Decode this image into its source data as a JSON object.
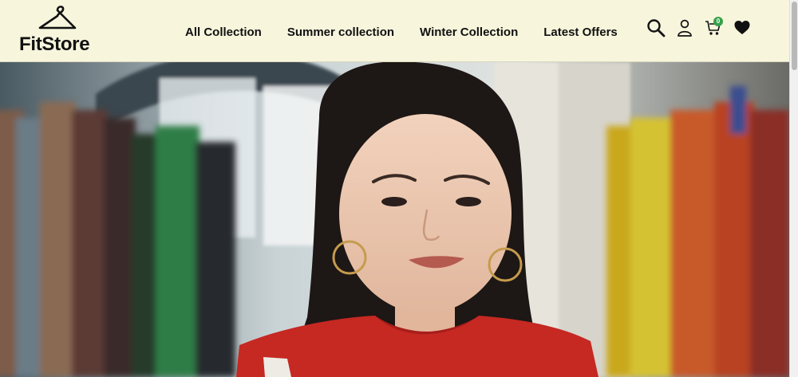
{
  "brand": {
    "name": "FitStore",
    "logo_icon": "hanger-icon"
  },
  "nav": {
    "items": [
      {
        "label": "All Collection"
      },
      {
        "label": "Summer collection"
      },
      {
        "label": "Winter Collection"
      },
      {
        "label": "Latest Offers"
      }
    ]
  },
  "actions": {
    "search_icon": "search-icon",
    "user_icon": "user-icon",
    "cart_icon": "cart-icon",
    "cart_count": "0",
    "wishlist_icon": "heart-icon"
  },
  "hero": {
    "image_alt": "Woman smiling among clothing racks",
    "colors": {
      "header_bg": "#f7f5dc",
      "badge": "#35a14a",
      "sweater": "#c62822"
    }
  }
}
